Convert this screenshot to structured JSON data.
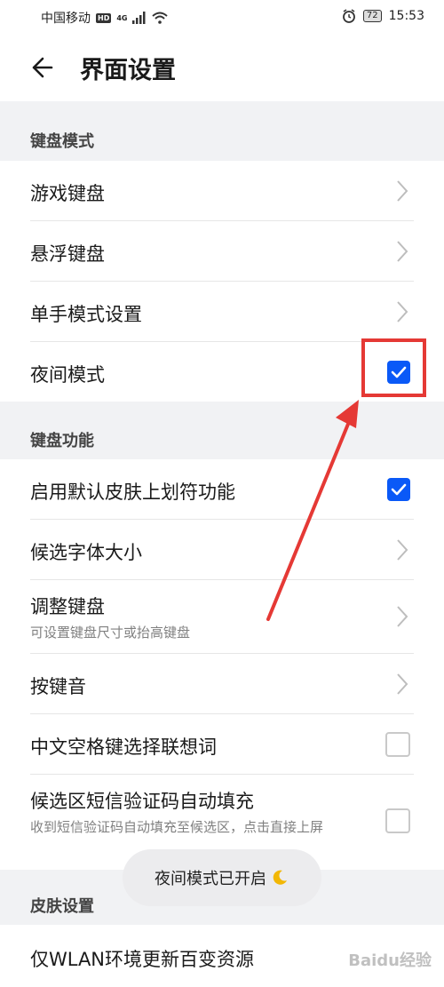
{
  "status_bar": {
    "carrier": "中国移动",
    "hd_badge": "HD",
    "net_type": "4G",
    "battery": "72",
    "time": "15:53"
  },
  "header": {
    "title": "界面设置"
  },
  "sections": {
    "keyboard_mode": {
      "label": "键盘模式",
      "rows": [
        {
          "label": "游戏键盘"
        },
        {
          "label": "悬浮键盘"
        },
        {
          "label": "单手模式设置"
        },
        {
          "label": "夜间模式",
          "checked": true
        }
      ]
    },
    "keyboard_function": {
      "label": "键盘功能",
      "rows": [
        {
          "label": "启用默认皮肤上划符功能",
          "checked": true
        },
        {
          "label": "候选字体大小"
        },
        {
          "label": "调整键盘",
          "sub": "可设置键盘尺寸或抬高键盘"
        },
        {
          "label": "按键音"
        },
        {
          "label": "中文空格键选择联想词",
          "checked": false
        },
        {
          "label": "候选区短信验证码自动填充",
          "sub": "收到短信验证码自动填充至候选区，点击直接上屏",
          "checked": false
        }
      ]
    },
    "skin": {
      "label": "皮肤设置",
      "rows": [
        {
          "label": "仅WLAN环境更新百变资源"
        }
      ]
    }
  },
  "toast": {
    "text": "夜间模式已开启"
  },
  "watermark": {
    "text": "Baidu经验"
  },
  "colors": {
    "accent": "#0a59f7",
    "annotation": "#e53935"
  }
}
